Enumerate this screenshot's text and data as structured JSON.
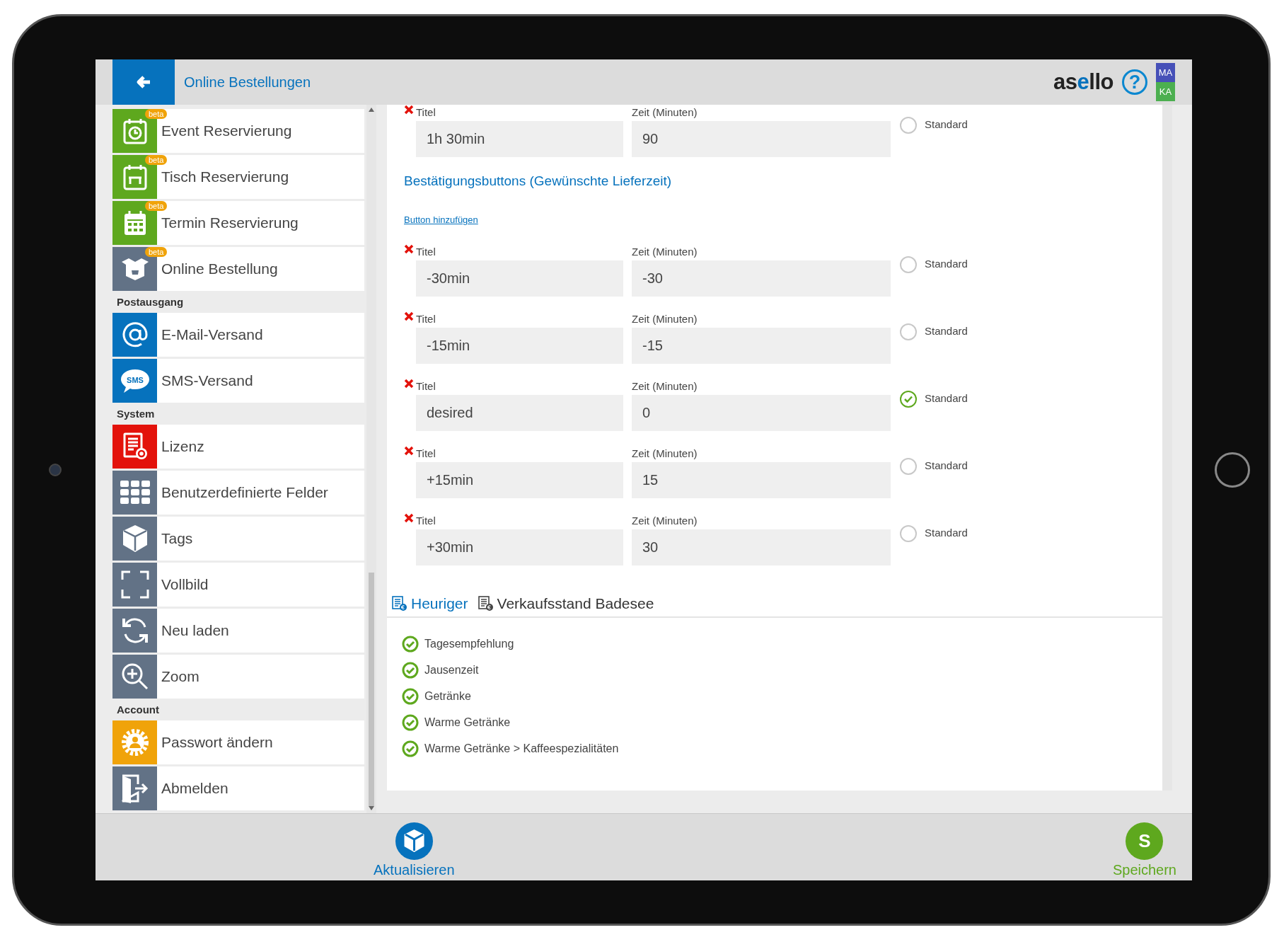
{
  "header": {
    "title": "Online Bestellungen",
    "logo": [
      {
        "text": "as",
        "accent": false
      },
      {
        "text": "e",
        "accent": true
      },
      {
        "text": "llo",
        "accent": false
      }
    ],
    "help": "?",
    "users": [
      {
        "label": "MA",
        "color": "#4650b8"
      },
      {
        "label": "KA",
        "color": "#4caf50"
      }
    ]
  },
  "sidebar": {
    "sections": [
      {
        "items": [
          {
            "label": "Event Reservierung",
            "color": "#5ea81e",
            "badge": "beta"
          },
          {
            "label": "Tisch Reservierung",
            "color": "#5ea81e",
            "badge": "beta"
          },
          {
            "label": "Termin Reservierung",
            "color": "#5ea81e",
            "badge": "beta"
          },
          {
            "label": "Online Bestellung",
            "color": "#627286",
            "badge": "beta"
          }
        ]
      },
      {
        "title": "Postausgang",
        "items": [
          {
            "label": "E-Mail-Versand",
            "color": "#0672bd"
          },
          {
            "label": "SMS-Versand",
            "color": "#0672bd",
            "icon_text": "SMS"
          }
        ]
      },
      {
        "title": "System",
        "items": [
          {
            "label": "Lizenz",
            "color": "#e3120b"
          },
          {
            "label": "Benutzerdefinierte Felder",
            "color": "#627286"
          },
          {
            "label": "Tags",
            "color": "#627286"
          },
          {
            "label": "Vollbild",
            "color": "#627286"
          },
          {
            "label": "Neu laden",
            "color": "#627286"
          },
          {
            "label": "Zoom",
            "color": "#627286"
          }
        ]
      },
      {
        "title": "Account",
        "items": [
          {
            "label": "Passwort ändern",
            "color": "#f0a30a"
          },
          {
            "label": "Abmelden",
            "color": "#627286"
          }
        ]
      }
    ]
  },
  "main": {
    "top_rows": [
      {
        "title_label": "Titel",
        "time_label": "Zeit (Minuten)",
        "title_value": "1h 30min",
        "time_value": "90",
        "default_label": "Standard",
        "selected": false
      }
    ],
    "heading": "Bestätigungsbuttons (Gewünschte Lieferzeit)",
    "add_link": "Button hinzufügen",
    "rows": [
      {
        "title_label": "Titel",
        "time_label": "Zeit (Minuten)",
        "title_value": "-30min",
        "time_value": "-30",
        "default_label": "Standard",
        "selected": false
      },
      {
        "title_label": "Titel",
        "time_label": "Zeit (Minuten)",
        "title_value": "-15min",
        "time_value": "-15",
        "default_label": "Standard",
        "selected": false
      },
      {
        "title_label": "Titel",
        "time_label": "Zeit (Minuten)",
        "title_value": "desired",
        "time_value": "0",
        "default_label": "Standard",
        "selected": true
      },
      {
        "title_label": "Titel",
        "time_label": "Zeit (Minuten)",
        "title_value": "+15min",
        "time_value": "15",
        "default_label": "Standard",
        "selected": false
      },
      {
        "title_label": "Titel",
        "time_label": "Zeit (Minuten)",
        "title_value": "+30min",
        "time_value": "30",
        "default_label": "Standard",
        "selected": false
      }
    ],
    "tabs": [
      {
        "label": "Heuriger",
        "selected": true
      },
      {
        "label": "Verkaufsstand Badesee",
        "selected": false
      }
    ],
    "categories": [
      {
        "label": "Tagesempfehlung",
        "checked": true
      },
      {
        "label": "Jausenzeit",
        "checked": true
      },
      {
        "label": "Getränke",
        "checked": true
      },
      {
        "label": "Warme Getränke",
        "checked": true
      },
      {
        "label": "Warme Getränke > Kaffeespezialitäten",
        "checked": true
      }
    ]
  },
  "footer": {
    "refresh": {
      "label": "Aktualisieren"
    },
    "save": {
      "label": "Speichern",
      "icon_text": "S"
    }
  }
}
